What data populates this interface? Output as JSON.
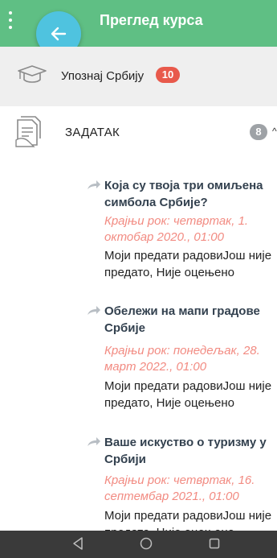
{
  "header": {
    "title": "Преглед курса",
    "back_icon": "arrow-left-icon",
    "menu_icon": "kebab-menu-icon"
  },
  "course": {
    "name": "Упознај Србију",
    "badge": "10",
    "icon": "graduation-cap-icon"
  },
  "section": {
    "label": "ЗАДАТАК",
    "badge": "8",
    "icon": "assignment-document-icon"
  },
  "assignments": [
    {
      "title_line1": "Која су твоја три омиљена",
      "title_line2": "симбола Србије?",
      "due_line1": "Крајњи рок: четвртак, 1.",
      "due_line2": "октобар 2020., 01:00",
      "status_line1": "Моји предати радовиЈош није",
      "status_line2": "предато, Није оцењено"
    },
    {
      "title_line1": "Обележи на мапи градове",
      "title_line2": "Србије",
      "due_line1": "Крајњи рок: понедељак, 28.",
      "due_line2": "март 2022., 01:00",
      "status_line1": "Моји предати радовиЈош није",
      "status_line2": "предато, Није оцењено"
    },
    {
      "title_line1": "Ваше искуство о туризму у",
      "title_line2": "Србији",
      "due_line1": "Крајњи рок: четвртак, 16.",
      "due_line2": "септембар 2021., 01:00",
      "status_line1": "Моји предати радовиЈош није",
      "status_line2": "предато, Није оцењено"
    }
  ],
  "colors": {
    "appbar": "#5fbf84",
    "fab": "#4fc3df",
    "badge_red": "#e8594b",
    "due": "#f28b82",
    "navbar": "#3a3a3a"
  },
  "navbar": {
    "icons": [
      "back-triangle-icon",
      "home-circle-icon",
      "recents-square-icon"
    ]
  }
}
